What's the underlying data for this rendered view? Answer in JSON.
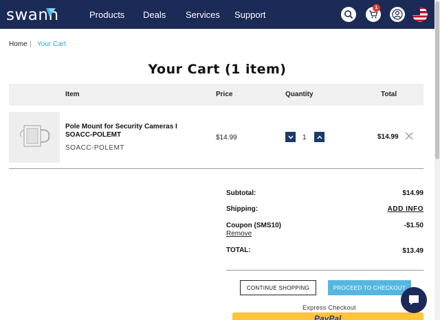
{
  "header": {
    "logo_text": "swann",
    "nav": [
      "Products",
      "Deals",
      "Services",
      "Support"
    ],
    "cart_count": "1",
    "icons": [
      "search-icon",
      "cart-icon",
      "user-icon",
      "us-flag-icon"
    ],
    "colors": {
      "header_bg": "#1b2a57",
      "badge": "#e4392b"
    }
  },
  "breadcrumb": {
    "home": "Home",
    "separator": "|",
    "current": "Your Cart"
  },
  "page_title": "Your Cart (1 item)",
  "table": {
    "headers": {
      "item": "Item",
      "price": "Price",
      "quantity": "Quantity",
      "total": "Total"
    },
    "rows": [
      {
        "name": "Pole Mount for Security Cameras I SOACC-POLEMT",
        "sku": "SOACC-POLEMT",
        "price": "$14.99",
        "quantity": "1",
        "total": "$14.99"
      }
    ]
  },
  "summary": {
    "subtotal_label": "Subtotal:",
    "subtotal_value": "$14.99",
    "shipping_label": "Shipping:",
    "shipping_value": "ADD INFO",
    "coupon_label": "Coupon (SMS10)",
    "coupon_value": "-$1.50",
    "remove_label": "Remove",
    "total_label": "TOTAL:",
    "total_value": "$13.49"
  },
  "actions": {
    "continue": "CONTINUE SHOPPING",
    "checkout": "PROCEED TO CHECKOUT",
    "express": "Express Checkout",
    "paypal": "PayPal",
    "colors": {
      "checkout_bg": "#55b7e0",
      "paypal_bg": "#ffc439"
    }
  }
}
